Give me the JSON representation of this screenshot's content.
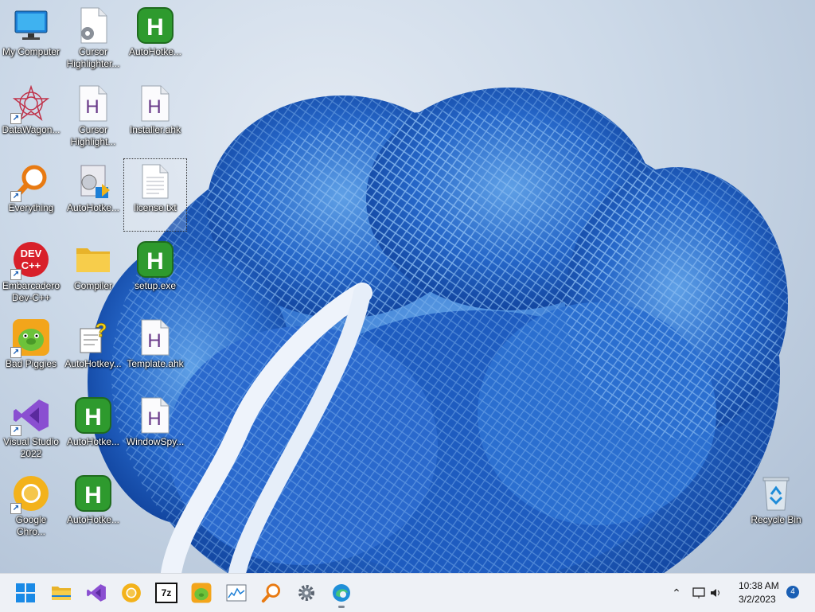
{
  "desktop": {
    "icons": [
      {
        "label": "My Computer",
        "icon": "monitor-icon"
      },
      {
        "label": "Cursor Highlighter...",
        "icon": "settings-file-icon"
      },
      {
        "label": "AutoHotke...",
        "icon": "autohotkey-icon"
      },
      {
        "label": "DataWagon...",
        "icon": "datawagon-icon"
      },
      {
        "label": "Cursor Highlight...",
        "icon": "ahk-script-icon"
      },
      {
        "label": "Installer.ahk",
        "icon": "ahk-script-icon"
      },
      {
        "label": "Everything",
        "icon": "search-magnifier-icon"
      },
      {
        "label": "AutoHotke...",
        "icon": "installer-icon"
      },
      {
        "label": "license.txt",
        "icon": "text-file-icon"
      },
      {
        "label": "Embarcadero Dev-C++",
        "icon": "devcpp-icon"
      },
      {
        "label": "Compiler",
        "icon": "folder-icon"
      },
      {
        "label": "setup.exe",
        "icon": "autohotkey-icon"
      },
      {
        "label": "Bad Piggies",
        "icon": "bad-piggies-icon"
      },
      {
        "label": "AutoHotkey...",
        "icon": "help-file-icon"
      },
      {
        "label": "Template.ahk",
        "icon": "ahk-script-icon"
      },
      {
        "label": "Visual Studio 2022",
        "icon": "visual-studio-icon"
      },
      {
        "label": "AutoHotke...",
        "icon": "autohotkey-icon"
      },
      {
        "label": "WindowSpy...",
        "icon": "ahk-script-icon"
      },
      {
        "label": "Google Chro...",
        "icon": "chrome-icon"
      },
      {
        "label": "AutoHotke...",
        "icon": "autohotkey-icon"
      },
      {
        "label": "Recycle Bin",
        "icon": "recycle-bin-icon"
      }
    ]
  },
  "taskbar": {
    "apps": [
      {
        "name": "Start",
        "icon": "windows-start-icon"
      },
      {
        "name": "File Explorer",
        "icon": "file-explorer-icon"
      },
      {
        "name": "Visual Studio",
        "icon": "visual-studio-icon"
      },
      {
        "name": "Google Chrome",
        "icon": "chrome-icon"
      },
      {
        "name": "7-Zip",
        "icon": "seven-zip-icon"
      },
      {
        "name": "Bad Piggies",
        "icon": "bad-piggies-icon"
      },
      {
        "name": "Resource Monitor",
        "icon": "chart-icon"
      },
      {
        "name": "Everything",
        "icon": "search-magnifier-icon"
      },
      {
        "name": "Settings",
        "icon": "gear-icon"
      },
      {
        "name": "Microsoft Edge",
        "icon": "edge-icon"
      }
    ],
    "seven_zip_text": "7z",
    "tray": {
      "time": "10:38 AM",
      "date": "3/2/2023",
      "notification_count": "4"
    }
  }
}
